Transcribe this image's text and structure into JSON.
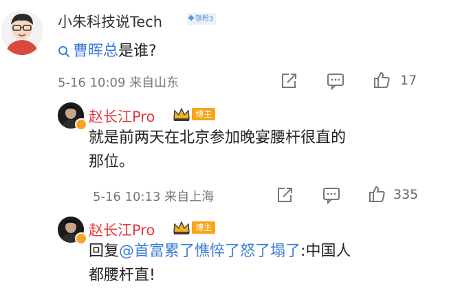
{
  "comment": {
    "username": "小朱科技说Tech",
    "level_badge": "铁粉3",
    "question_link": "曹晖总",
    "question_rest": "是谁?",
    "meta": "5-16 10:09 来自山东",
    "likes": "17"
  },
  "replies": [
    {
      "username": "赵长江Pro",
      "badge": "博主",
      "text_line1": "就是前两天在北京参加晚宴腰杆很直的",
      "text_line2": "那位。",
      "meta": "5-16 10:13 来自上海",
      "likes": "335"
    },
    {
      "username": "赵长江Pro",
      "badge": "博主",
      "text_prefix": "回复",
      "mention": "@首富累了憔悴了怒了塌了",
      "text_suffix": ":中国人",
      "text_line2": "都腰杆直!"
    }
  ],
  "colors": {
    "accent_link": "#3b7dd8",
    "username_red": "#e4393c",
    "badge_orange": "#f7a51b"
  },
  "icons": [
    "search-icon",
    "share-icon",
    "comment-icon",
    "thumbs-up-icon",
    "crown-icon"
  ]
}
